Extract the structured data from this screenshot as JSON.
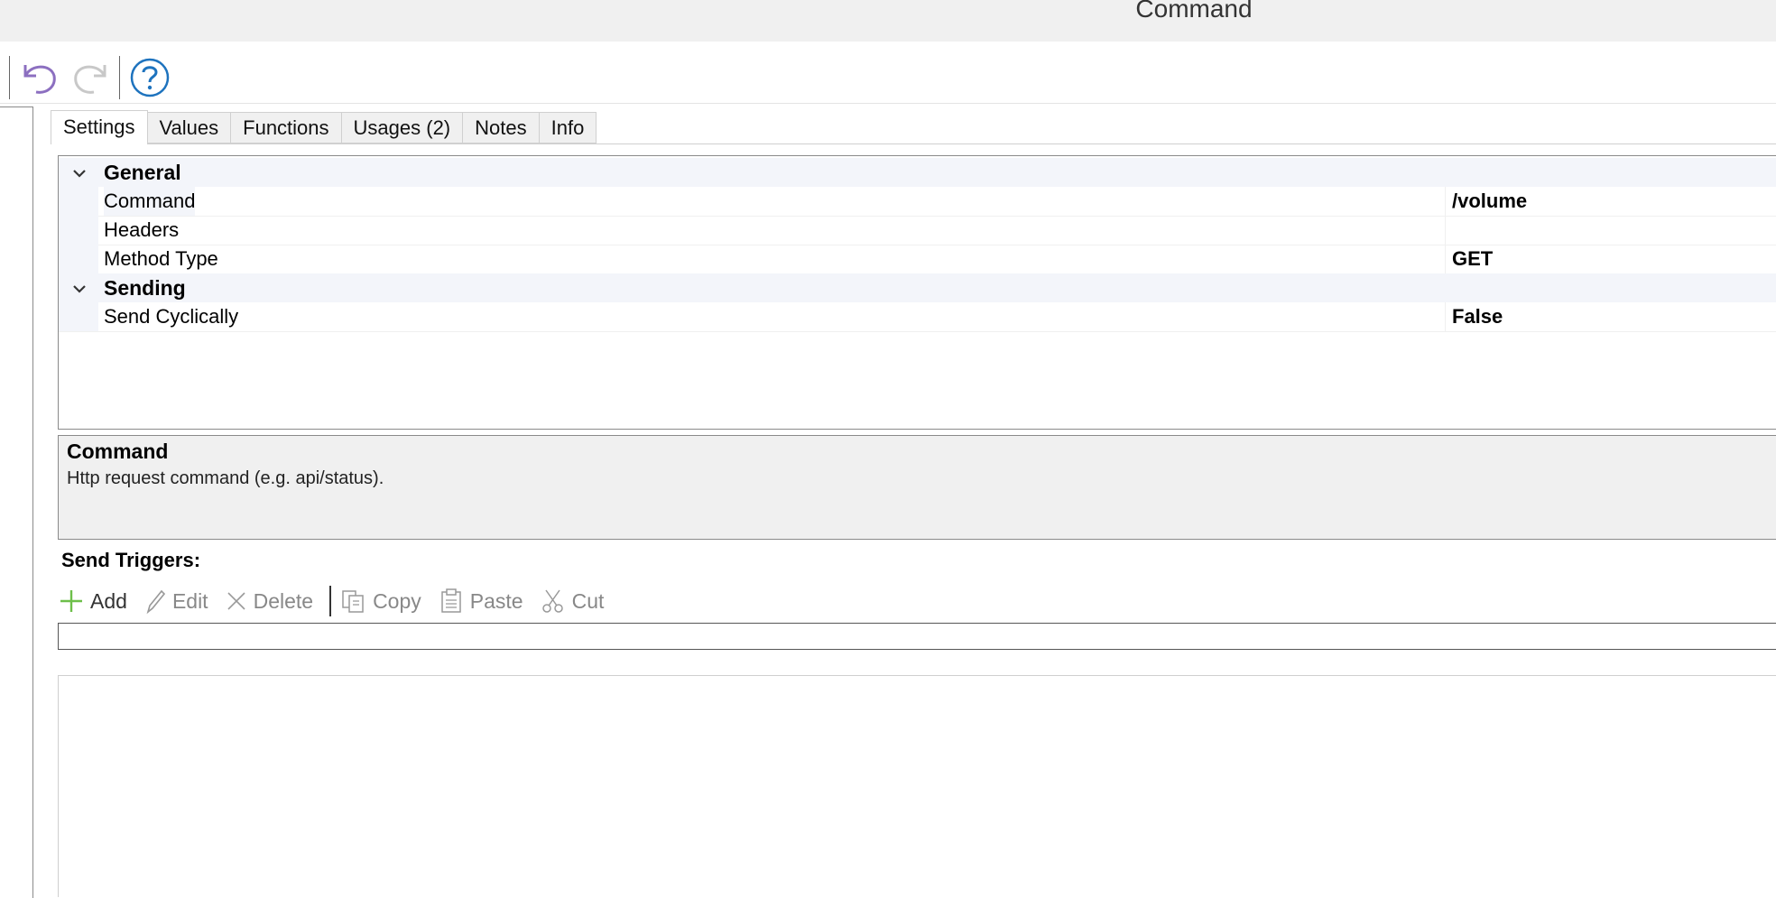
{
  "window": {
    "title": "Command"
  },
  "tabs": [
    {
      "label": "Settings",
      "active": true
    },
    {
      "label": "Values"
    },
    {
      "label": "Functions"
    },
    {
      "label": "Usages (2)"
    },
    {
      "label": "Notes"
    },
    {
      "label": "Info"
    }
  ],
  "grid": {
    "categories": [
      {
        "name": "General",
        "props": [
          {
            "label": "Command",
            "value": "/volume"
          },
          {
            "label": "Headers",
            "value": ""
          },
          {
            "label": "Method Type",
            "value": "GET"
          }
        ]
      },
      {
        "name": "Sending",
        "props": [
          {
            "label": "Send Cyclically",
            "value": "False"
          }
        ]
      }
    ]
  },
  "description": {
    "title": "Command",
    "text": "Http request command (e.g. api/status)."
  },
  "send_triggers": {
    "label": "Send Triggers:",
    "buttons": {
      "add": "Add",
      "edit": "Edit",
      "delete": "Delete",
      "copy": "Copy",
      "paste": "Paste",
      "cut": "Cut"
    }
  },
  "colors": {
    "accent": "#1e73be",
    "undo": "#8c6fc0",
    "category_bg": "#f3f5fa"
  }
}
